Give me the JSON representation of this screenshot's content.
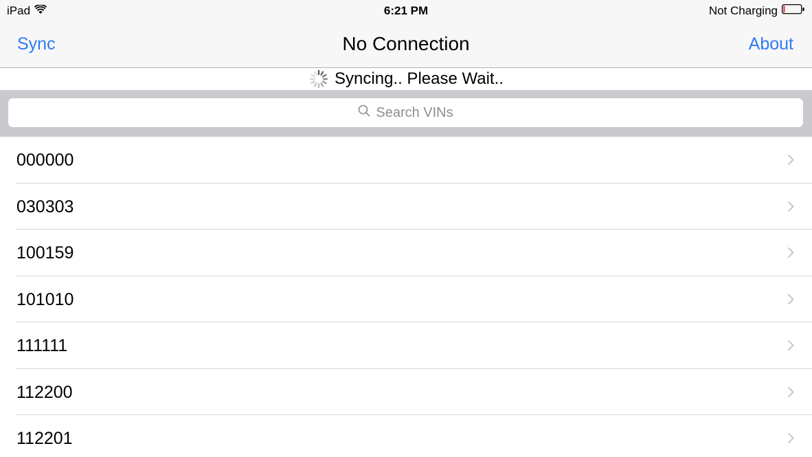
{
  "status_bar": {
    "device": "iPad",
    "time": "6:21 PM",
    "battery_status": "Not Charging",
    "icons": [
      "wifi-icon",
      "battery-icon"
    ]
  },
  "nav_bar": {
    "left_button": "Sync",
    "title": "No Connection",
    "right_button": "About"
  },
  "sync_banner": {
    "text": "Syncing.. Please Wait..",
    "icon": "spinner-icon"
  },
  "search": {
    "placeholder": "Search VINs",
    "icon": "search-icon"
  },
  "vin_list": {
    "items": [
      {
        "label": "000000"
      },
      {
        "label": "030303"
      },
      {
        "label": "100159"
      },
      {
        "label": "101010"
      },
      {
        "label": "111111"
      },
      {
        "label": "112200"
      },
      {
        "label": "112201"
      }
    ]
  },
  "colors": {
    "accent": "#2e7cf6",
    "bar_background": "#f7f7f7",
    "search_tray": "#c9c9ce",
    "placeholder": "#8e8e93",
    "separator": "#d7d7db",
    "chevron": "#c7c7cc"
  }
}
